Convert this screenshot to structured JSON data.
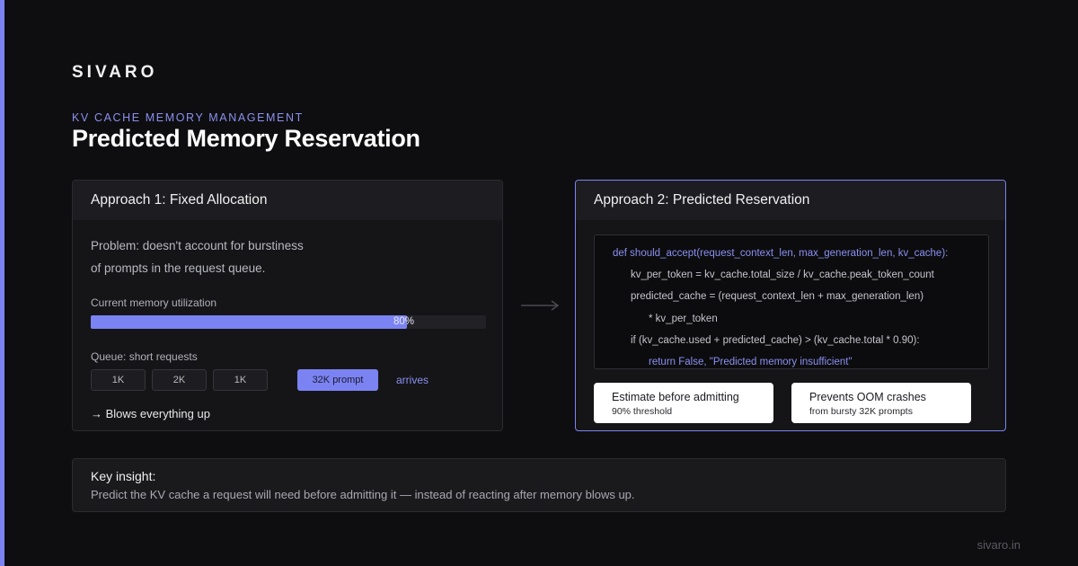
{
  "brand": "SIVARO",
  "kicker": "KV CACHE MEMORY MANAGEMENT",
  "title": "Predicted Memory Reservation",
  "approach1": {
    "title": "Approach 1: Fixed Allocation",
    "problem_line1": "Problem: doesn't account for burstiness",
    "problem_line2": "of prompts in the request queue.",
    "memory_label": "Current memory utilization",
    "memory_utilization": 0.8,
    "memory_label_pct": "80%",
    "queue_label": "Queue: short requests",
    "queue": [
      "1K",
      "2K",
      "1K"
    ],
    "big_prompt": "32K prompt",
    "arrives": "arrives",
    "outcome": "→ Blows everything up"
  },
  "approach2": {
    "title": "Approach 2: Predicted Reservation",
    "code": [
      {
        "indent": 0,
        "text": "def should_accept(request_context_len, max_generation_len, kv_cache):",
        "highlight": true
      },
      {
        "indent": 1,
        "text": "kv_per_token = kv_cache.total_size / kv_cache.peak_token_count",
        "highlight": false
      },
      {
        "indent": 1,
        "text": "predicted_cache = (request_context_len + max_generation_len)",
        "highlight": false
      },
      {
        "indent": 2,
        "text": "* kv_per_token",
        "highlight": false
      },
      {
        "indent": 1,
        "text": "if (kv_cache.used + predicted_cache) > (kv_cache.total * 0.90):",
        "highlight": false
      },
      {
        "indent": 2,
        "text": "return False, \"Predicted memory insufficient\"",
        "highlight": true
      }
    ],
    "pill1": {
      "title": "Estimate before admitting",
      "subtitle": "90% threshold"
    },
    "pill2": {
      "title": "Prevents OOM crashes",
      "subtitle": "from bursty 32K prompts"
    }
  },
  "insight": {
    "heading": "Key insight:",
    "body": "Predict the KV cache a request will need before admitting it — instead of reacting after memory blows up."
  },
  "footer": "sivaro.in",
  "colors": {
    "accent": "#7b83f2",
    "background": "#0e0e10",
    "card": "#151518"
  }
}
